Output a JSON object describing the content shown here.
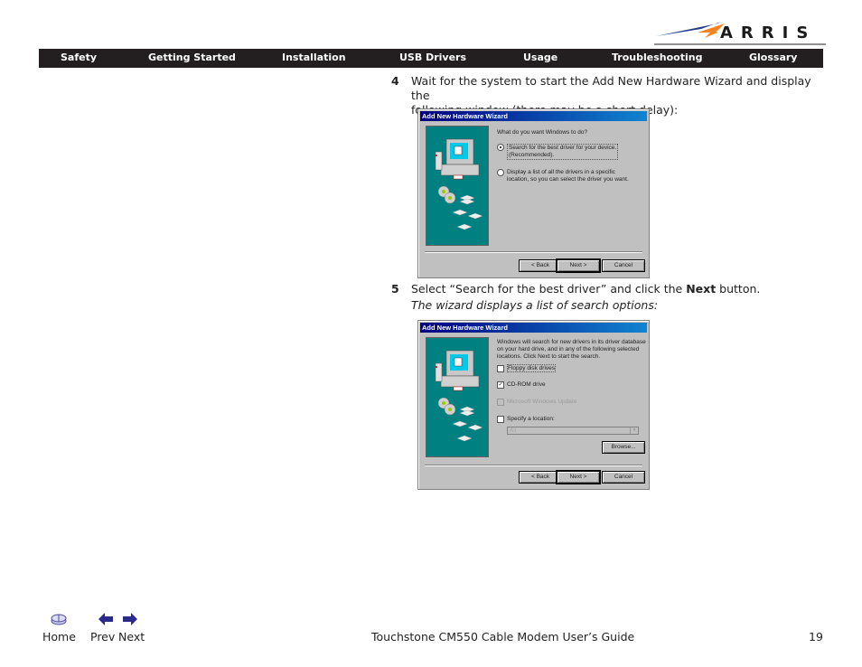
{
  "brand": {
    "name": "ARRIS",
    "accent_colors": {
      "blue": "#1f3d8a",
      "orange": "#f58220",
      "navbar": "#231f20"
    }
  },
  "nav": {
    "items": [
      {
        "label": "Safety"
      },
      {
        "label": "Getting Started"
      },
      {
        "label": "Installation"
      },
      {
        "label": "USB Drivers"
      },
      {
        "label": "Usage"
      },
      {
        "label": "Troubleshooting"
      },
      {
        "label": "Glossary"
      }
    ]
  },
  "content": {
    "step4": {
      "number": "4",
      "text_line1": "Wait for the system to start the Add New Hardware Wizard and display the",
      "text_line2": "following window (there may be a short delay):"
    },
    "wizard1": {
      "title": "Add New Hardware Wizard",
      "question": "What do you want Windows to do?",
      "option1_line1": "Search for the best driver for your device.",
      "option1_line2": "(Recommended).",
      "option1_selected": true,
      "option2_line1": "Display a list of all the drivers in a specific",
      "option2_line2": "location, so you can select the driver you want.",
      "option2_selected": false,
      "buttons": {
        "back": "< Back",
        "next": "Next >",
        "cancel": "Cancel"
      }
    },
    "step5": {
      "number": "5",
      "text_pre": "Select “Search for the best driver” and click the ",
      "text_bold": "Next",
      "text_post": " button.",
      "result": "The wizard displays a list of search options:"
    },
    "wizard2": {
      "title": "Add New Hardware Wizard",
      "intro_line1": "Windows will search for new drivers in its driver database",
      "intro_line2": "on your hard drive, and in any of the following selected",
      "intro_line3": "locations. Click Next to start the search.",
      "options": [
        {
          "label": "Floppy disk drives",
          "checked": false,
          "disabled": false
        },
        {
          "label": "CD-ROM drive",
          "checked": true,
          "disabled": false
        },
        {
          "label": "Microsoft Windows Update",
          "checked": false,
          "disabled": true
        },
        {
          "label": "Specify a location:",
          "checked": false,
          "disabled": false
        }
      ],
      "location_value": "A:\\",
      "browse": "Browse...",
      "buttons": {
        "back": "< Back",
        "next": "Next >",
        "cancel": "Cancel"
      }
    }
  },
  "footer": {
    "home": "Home",
    "prev": "Prev",
    "next": "Next",
    "title": "Touchstone CM550 Cable Modem User’s Guide",
    "page": "19"
  }
}
